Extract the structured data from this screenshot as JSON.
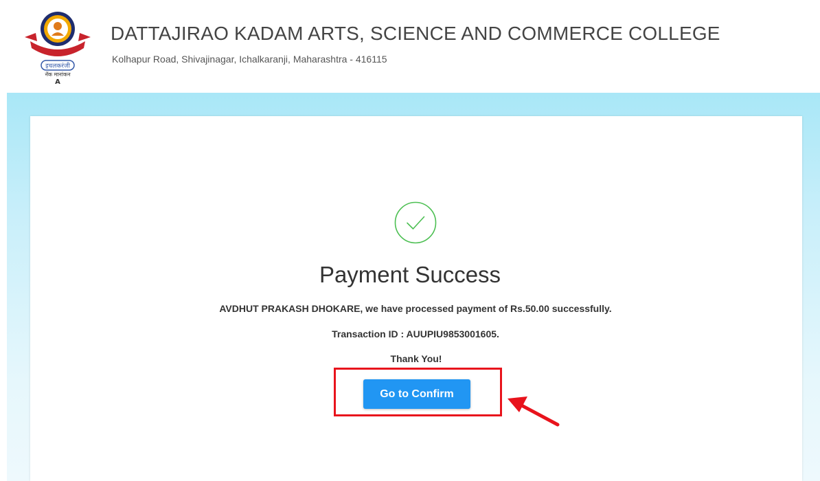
{
  "header": {
    "college_name": "DATTAJIRAO KADAM ARTS, SCIENCE AND COMMERCE COLLEGE",
    "address": "Kolhapur Road, Shivajinagar, Ichalkaranji, Maharashtra - 416115",
    "logo": {
      "icon": "college-emblem-icon",
      "text_top": "इचलकरंजी",
      "text_bottom": "नॅक मानांकन",
      "grade": "A"
    }
  },
  "payment": {
    "status_icon": "check-circle-icon",
    "title": "Payment Success",
    "message": "AVDHUT PRAKASH DHOKARE, we have processed payment of Rs.50.00 successfully.",
    "transaction": "Transaction ID : AUUPIU9853001605.",
    "thanks": "Thank You!",
    "confirm_label": "Go to Confirm"
  },
  "colors": {
    "accent_button": "#2196f3",
    "success_green": "#4cbf52",
    "highlight_red": "#e8131c",
    "band_top": "#a9e7f7"
  }
}
